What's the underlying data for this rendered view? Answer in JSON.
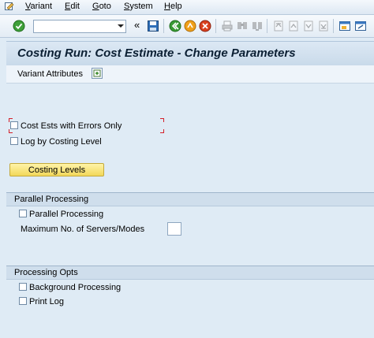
{
  "menu": {
    "items": [
      {
        "label": "Variant",
        "ul": "V",
        "rest": "ariant"
      },
      {
        "label": "Edit",
        "ul": "E",
        "rest": "dit"
      },
      {
        "label": "Goto",
        "ul": "G",
        "rest": "oto"
      },
      {
        "label": "System",
        "ul": "S",
        "rest": "ystem"
      },
      {
        "label": "Help",
        "ul": "H",
        "rest": "elp"
      }
    ]
  },
  "toolbar": {
    "command_field_value": "",
    "back_chevron": "«"
  },
  "title": "Costing Run: Cost Estimate - Change Parameters",
  "appbar": {
    "variant_attributes_label": "Variant Attributes"
  },
  "options": {
    "cost_ests_errors_label": "Cost Ests with Errors Only",
    "log_by_level_label": "Log by Costing Level"
  },
  "costing_levels_button": "Costing Levels",
  "parallel_group": {
    "title": "Parallel Processing",
    "checkbox_label": "Parallel Processing",
    "max_servers_label": "Maximum No. of Servers/Modes",
    "max_servers_value": ""
  },
  "processing_group": {
    "title": "Processing Opts",
    "background_label": "Background Processing",
    "print_log_label": "Print Log"
  },
  "colors": {
    "background": "#dfebf5",
    "button_yellow": "#f2d75a",
    "title_text": "#0b1f33"
  }
}
